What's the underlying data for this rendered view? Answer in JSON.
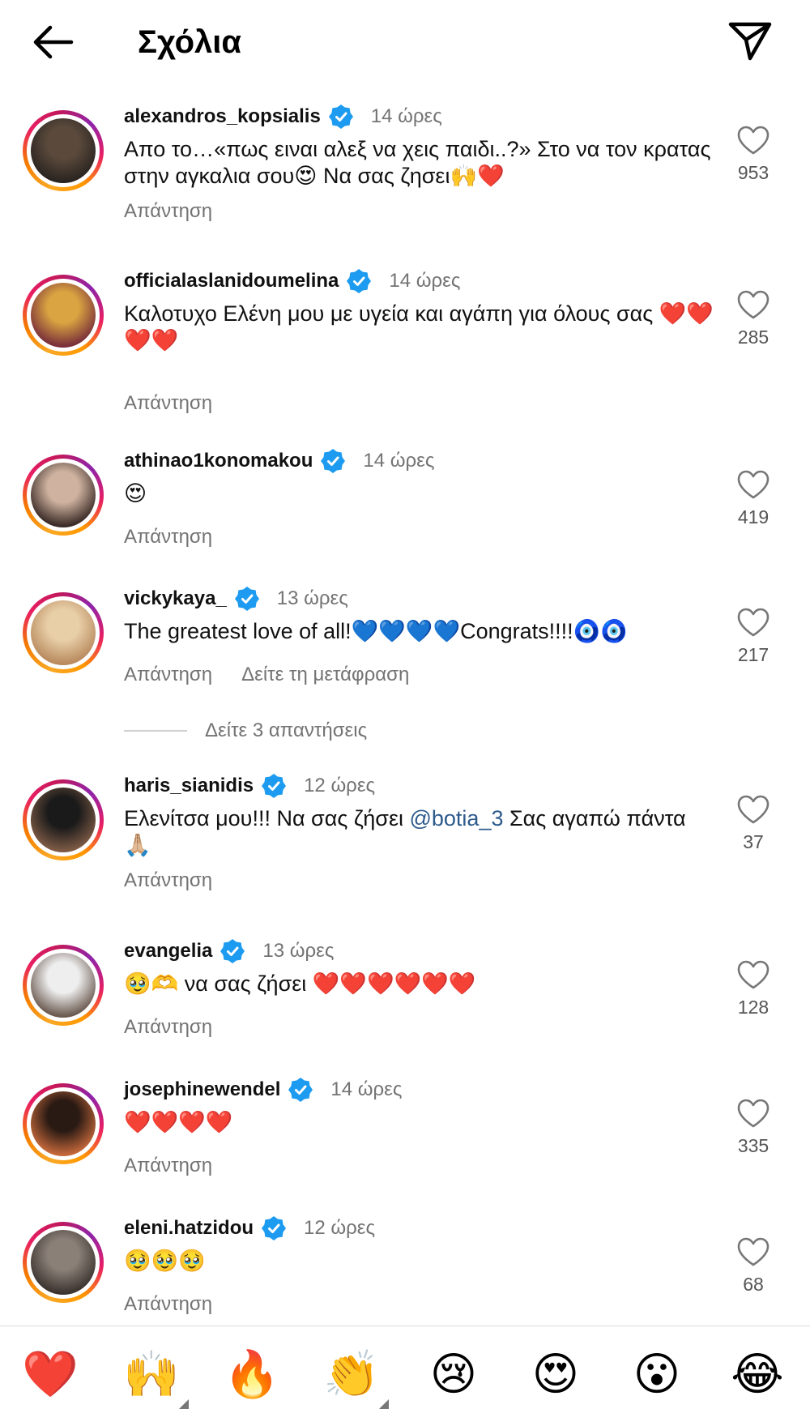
{
  "header": {
    "title": "Σχόλια"
  },
  "colors": {
    "verified": "#1d9bf0",
    "mention": "#2d5a8c",
    "secondary_text": "#737373"
  },
  "comments": [
    {
      "username": "alexandros_kopsialis",
      "time": "14 ώρες",
      "text": "Απο το…«πως ειναι αλεξ να χεις παιδι..?» Στο να τον κρατας στην αγκαλια σου😍 Να σας ζησει🙌❤️",
      "reply_label": "Απάντηση",
      "likes": "953",
      "avatar_colors": [
        "#5b4a3c",
        "#2a2420"
      ]
    },
    {
      "username": "officialaslanidoumelina",
      "time": "14 ώρες",
      "text": "Καλοτυχο Ελένη μου με υγεία και αγάπη για όλους σας ❤️❤️❤️❤️",
      "reply_label": "Απάντηση",
      "likes": "285",
      "avatar_colors": [
        "#d9a441",
        "#7a2f3a"
      ]
    },
    {
      "username": "athinao1konomakou",
      "time": "14 ώρες",
      "text": "😍",
      "reply_label": "Απάντηση",
      "likes": "419",
      "avatar_colors": [
        "#cfb3a0",
        "#3a2a26"
      ]
    },
    {
      "username": "vickykaya_",
      "time": "13 ώρες",
      "text": "The greatest love of all!💙💙💙💙Congrats!!!!🧿🧿",
      "reply_label": "Απάντηση",
      "translate_label": "Δείτε τη μετάφραση",
      "likes": "217",
      "avatar_colors": [
        "#e8cfa8",
        "#b98a5e"
      ]
    },
    {
      "username": "haris_sianidis",
      "time": "12 ώρες",
      "text_before": "Ελενίτσα μου!!! Να σας ζήσει ",
      "mention": "@botia_3",
      "text_after": " Σας αγαπώ πάντα 🙏🏼",
      "reply_label": "Απάντηση",
      "likes": "37",
      "avatar_colors": [
        "#1a1a1a",
        "#7d5a45"
      ]
    },
    {
      "username": "evangelia",
      "time": "13 ώρες",
      "text": "🥹🫶 να σας ζήσει ❤️❤️❤️❤️❤️❤️",
      "reply_label": "Απάντηση",
      "likes": "128",
      "avatar_colors": [
        "#eeeeee",
        "#6b5a50"
      ]
    },
    {
      "username": "josephinewendel",
      "time": "14 ώρες",
      "text": "❤️❤️❤️❤️",
      "reply_label": "Απάντηση",
      "likes": "335",
      "avatar_colors": [
        "#2a1a14",
        "#c4683a"
      ]
    },
    {
      "username": "eleni.hatzidou",
      "time": "12 ώρες",
      "text": "🥹🥹🥹",
      "reply_label": "Απάντηση",
      "likes": "68",
      "avatar_colors": [
        "#8a8078",
        "#3b332e"
      ]
    }
  ],
  "view_replies": {
    "label": "Δείτε 3 απαντήσεις"
  },
  "emoji_bar": [
    {
      "emoji": "❤️",
      "name": "red-heart"
    },
    {
      "emoji": "🙌",
      "name": "raising-hands",
      "has_variants": true
    },
    {
      "emoji": "🔥",
      "name": "fire"
    },
    {
      "emoji": "👏",
      "name": "clapping-hands",
      "has_variants": true
    },
    {
      "emoji": "😢",
      "name": "crying-face"
    },
    {
      "emoji": "😍",
      "name": "heart-eyes"
    },
    {
      "emoji": "😮",
      "name": "open-mouth"
    },
    {
      "emoji": "😂",
      "name": "tears-of-joy"
    }
  ]
}
